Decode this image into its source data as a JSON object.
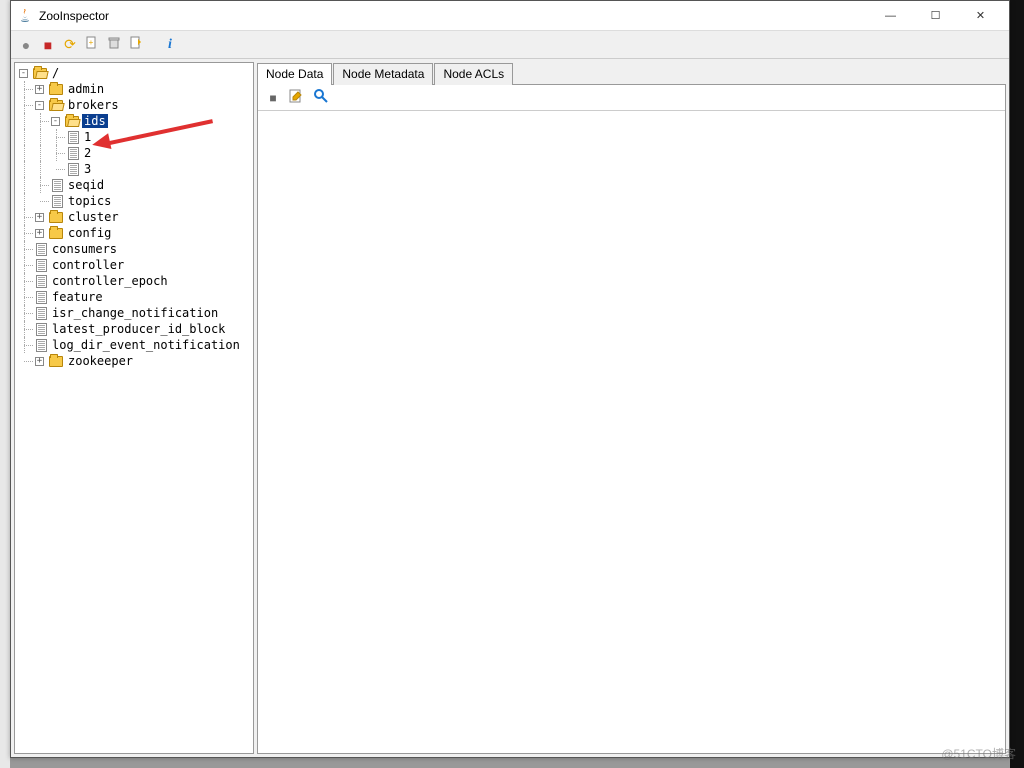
{
  "window": {
    "title": "ZooInspector"
  },
  "win_controls": {
    "min": "—",
    "max": "☐",
    "close": "✕"
  },
  "toolbar": {
    "connect": "●",
    "disconnect": "■",
    "refresh": "⟳",
    "add": "+",
    "delete": "🗑",
    "edit": "✎",
    "info": "i"
  },
  "tree": {
    "root": "/",
    "admin": "admin",
    "brokers": "brokers",
    "ids": "ids",
    "id1": "1",
    "id2": "2",
    "id3": "3",
    "seqid": "seqid",
    "topics": "topics",
    "cluster": "cluster",
    "config": "config",
    "consumers": "consumers",
    "controller": "controller",
    "controller_epoch": "controller_epoch",
    "feature": "feature",
    "isr_change_notification": "isr_change_notification",
    "latest_producer_id_block": "latest_producer_id_block",
    "log_dir_event_notification": "log_dir_event_notification",
    "zookeeper": "zookeeper"
  },
  "tabs": {
    "node_data": "Node Data",
    "node_metadata": "Node Metadata",
    "node_acls": "Node ACLs"
  },
  "subtoolbar": {
    "save": "■",
    "edit": "✎",
    "search": "🔍"
  },
  "watermark": "@51CTO博客"
}
